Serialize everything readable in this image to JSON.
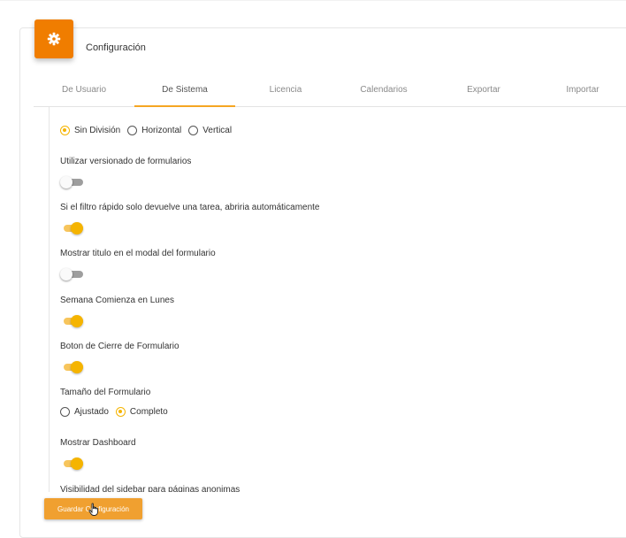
{
  "header": {
    "title": "Configuración",
    "icon": "gear-icon",
    "accent": "#f07d00"
  },
  "tabs": [
    {
      "label": "De Usuario",
      "active": false
    },
    {
      "label": "De Sistema",
      "active": true
    },
    {
      "label": "Licencia",
      "active": false
    },
    {
      "label": "Calendarios",
      "active": false
    },
    {
      "label": "Exportar",
      "active": false
    },
    {
      "label": "Importar",
      "active": false
    }
  ],
  "division": {
    "options": [
      "Sin División",
      "Horizontal",
      "Vertical"
    ],
    "selected": "Sin División"
  },
  "settings": [
    {
      "label": "Utilizar versionado de formularios",
      "on": false
    },
    {
      "label": "Si el filtro rápido solo devuelve una tarea, abriria automáticamente",
      "on": true
    },
    {
      "label": "Mostrar titulo en el modal del formulario",
      "on": false
    },
    {
      "label": "Semana Comienza en Lunes",
      "on": true
    },
    {
      "label": "Boton de Cierre de Formulario",
      "on": true
    }
  ],
  "form_size": {
    "label": "Tamaño del Formulario",
    "options": [
      "Ajustado",
      "Completo"
    ],
    "selected": "Completo"
  },
  "dashboard": {
    "label": "Mostrar Dashboard",
    "on": true
  },
  "sidebar_visibility": {
    "label": "Visibilidad del sidebar para páginas anonimas"
  },
  "save_button": {
    "label": "Guardar Configuración"
  },
  "colors": {
    "toggle_on": "#f5b400",
    "button": "#f0a030"
  }
}
